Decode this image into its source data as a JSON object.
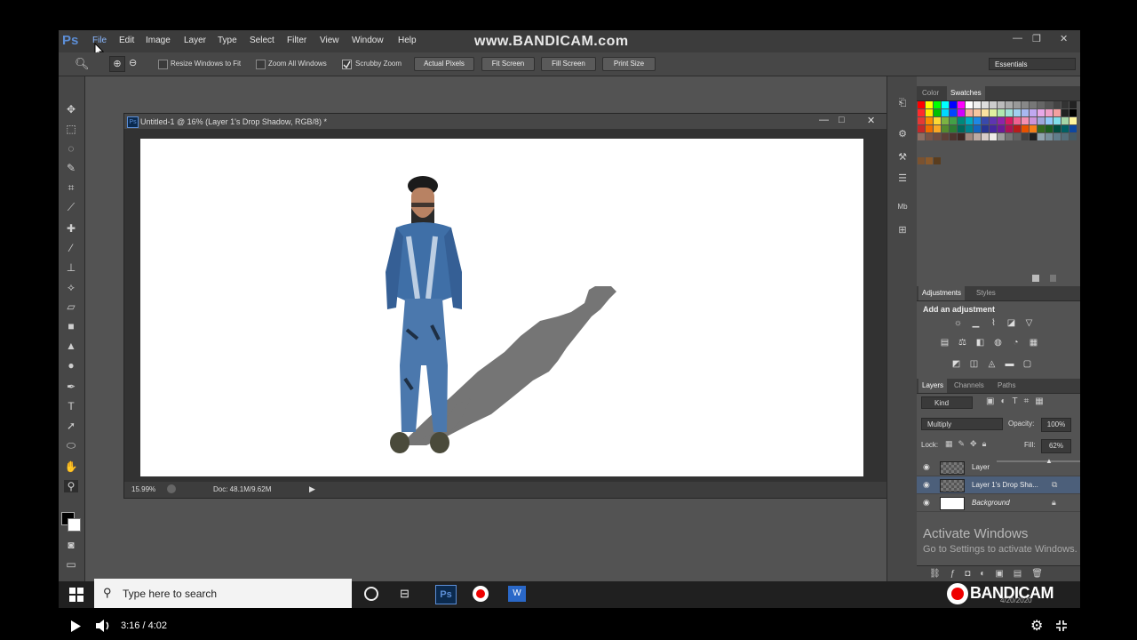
{
  "app": {
    "logo": "Ps",
    "watermark_top": "www.BANDICAM.com"
  },
  "menu": [
    "File",
    "Edit",
    "Image",
    "Layer",
    "Type",
    "Select",
    "Filter",
    "View",
    "Window",
    "Help"
  ],
  "window_controls": {
    "minimize": "—",
    "restore": "❐",
    "close": "✕"
  },
  "options_bar": {
    "resize_windows": "Resize Windows to Fit",
    "zoom_all": "Zoom All Windows",
    "scrubby_zoom": "Scrubby Zoom",
    "actual_pixels": "Actual Pixels",
    "fit_screen": "Fit Screen",
    "fill_screen": "Fill Screen",
    "print_size": "Print Size",
    "workspace": "Essentials"
  },
  "document": {
    "title": "Untitled-1 @ 16% (Layer 1's Drop Shadow, RGB/8) *",
    "zoom": "15.99%",
    "doc_size": "Doc: 48.1M/9.62M"
  },
  "panels": {
    "color_tabs": [
      "Color",
      "Swatches"
    ],
    "adjust_tabs": [
      "Adjustments",
      "Styles"
    ],
    "add_adjustment": "Add an adjustment",
    "layers_tabs": [
      "Layers",
      "Channels",
      "Paths"
    ],
    "kind": "Kind",
    "blend_mode": "Multiply",
    "opacity_label": "Opacity:",
    "opacity_value": "100%",
    "lock_label": "Lock:",
    "fill_label": "Fill:",
    "fill_value": "62%",
    "layers": [
      {
        "name": "Layer",
        "selected": false
      },
      {
        "name": "Layer 1's Drop Sha...",
        "selected": true
      },
      {
        "name": "Background",
        "selected": false
      }
    ]
  },
  "activate_windows": {
    "title": "Activate Windows",
    "subtitle": "Go to Settings to activate Windows."
  },
  "taskbar": {
    "search_placeholder": "Type here to search",
    "bandicam_logo": "BANDICAM",
    "date": "4/20/2020"
  },
  "player": {
    "time": "3:16 / 4:02",
    "progress": 0.81,
    "buffered": 0.855
  },
  "colors": {
    "accent": "#e00000",
    "ps_blue": "#5c8ed6"
  }
}
